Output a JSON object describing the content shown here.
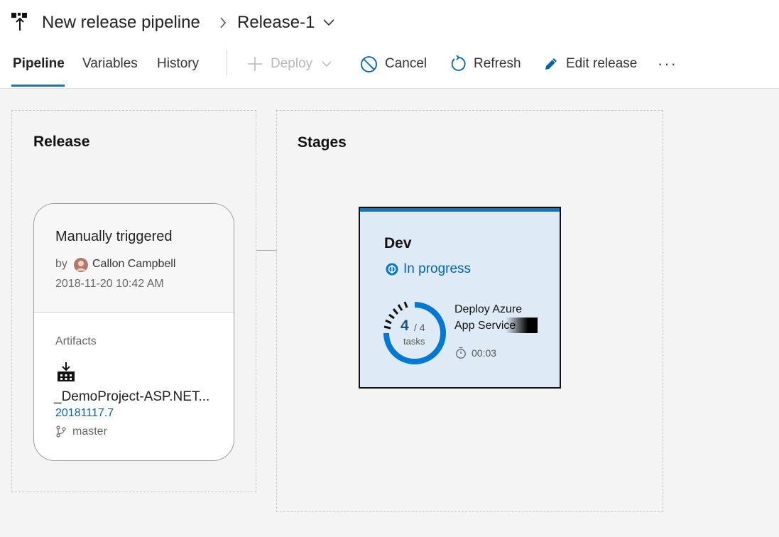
{
  "header": {
    "title": "New release pipeline",
    "breadcrumb_current": "Release-1",
    "icons": {
      "brand": "pipeline-icon",
      "separator": "chevron-right-icon",
      "dropdown": "chevron-down-icon"
    }
  },
  "tabs": [
    {
      "label": "Pipeline",
      "active": true
    },
    {
      "label": "Variables",
      "active": false
    },
    {
      "label": "History",
      "active": false
    }
  ],
  "toolbar": {
    "deploy": {
      "label": "Deploy",
      "icon": "plus-icon",
      "enabled": false
    },
    "cancel": {
      "label": "Cancel",
      "icon": "cancel-icon"
    },
    "refresh": {
      "label": "Refresh",
      "icon": "refresh-icon"
    },
    "edit": {
      "label": "Edit release",
      "icon": "pencil-icon"
    },
    "more": "···"
  },
  "release_panel": {
    "title": "Release",
    "trigger": "Manually triggered",
    "by_label": "by",
    "author": "Callon Campbell",
    "timestamp": "2018-11-20 10:42 AM",
    "artifacts_label": "Artifacts",
    "artifact_name": "_DemoProject-ASP.NET...",
    "artifact_version": "20181117.7",
    "branch": "master"
  },
  "stages_panel": {
    "title": "Stages",
    "stage": {
      "name": "Dev",
      "status": "In progress",
      "tasks_done": "4",
      "tasks_total": "/ 4",
      "tasks_label": "tasks",
      "task_name_line1": "Deploy Azure",
      "task_name_line2": "App Service",
      "duration": "00:03"
    }
  },
  "colors": {
    "accent": "#0078d4",
    "stage_bg": "#deebf7",
    "status_text": "#0063b1",
    "link": "#0063b1"
  }
}
